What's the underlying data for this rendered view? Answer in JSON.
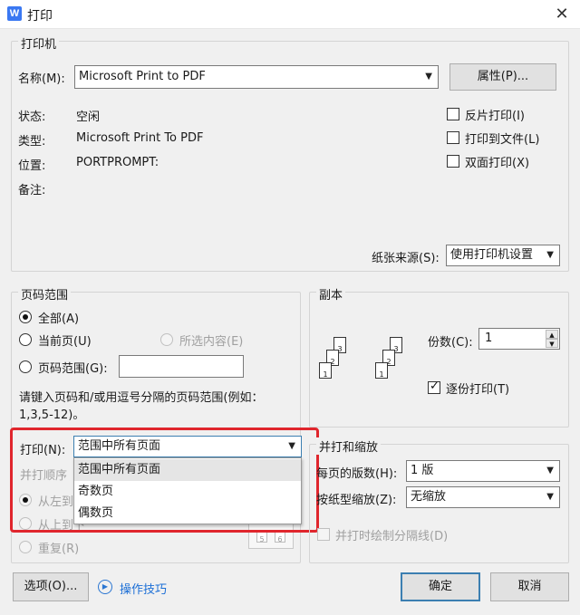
{
  "window": {
    "title": "打印",
    "app_icon": "W"
  },
  "printer": {
    "group_label": "打印机",
    "name_label": "名称(M):",
    "name_value": "Microsoft Print to PDF",
    "properties_button": "属性(P)...",
    "status_label": "状态:",
    "status_value": "空闲",
    "type_label": "类型:",
    "type_value": "Microsoft Print To PDF",
    "location_label": "位置:",
    "location_value": "PORTPROMPT:",
    "comment_label": "备注:",
    "options": [
      {
        "label": "反片打印(I)",
        "checked": false
      },
      {
        "label": "打印到文件(L)",
        "checked": false
      },
      {
        "label": "双面打印(X)",
        "checked": false
      }
    ],
    "paper_source_label": "纸张来源(S):",
    "paper_source_value": "使用打印机设置"
  },
  "page_range": {
    "group_label": "页码范围",
    "all": "全部(A)",
    "current": "当前页(U)",
    "selection": "所选内容(E)",
    "pages": "页码范围(G):",
    "hint_line1": "请键入页码和/或用逗号分隔的页码范围(例如：",
    "hint_line2": "1,3,5-12)。",
    "print_label": "打印(N):",
    "print_value": "范围中所有页面",
    "print_options": [
      "范围中所有页面",
      "奇数页",
      "偶数页"
    ],
    "order_label": "并打顺序",
    "order_options": [
      "从左到",
      "从上到下",
      "重复(R)"
    ]
  },
  "copies": {
    "group_label": "副本",
    "count_label": "份数(C):",
    "count_value": "1",
    "collate_label": "逐份打印(T)",
    "collate_checked": true
  },
  "zoom": {
    "group_label": "并打和缩放",
    "pages_per_sheet_label": "每页的版数(H):",
    "pages_per_sheet_value": "1 版",
    "scale_label": "按纸型缩放(Z):",
    "scale_value": "无缩放",
    "draw_separator_label": "并打时绘制分隔线(D)"
  },
  "footer": {
    "options_button": "选项(O)...",
    "tips_link": "操作技巧",
    "ok_button": "确定",
    "cancel_button": "取消"
  },
  "colors": {
    "accent": "#3c7fb1",
    "highlight_box": "#e0262d",
    "link": "#1c6fd6"
  }
}
